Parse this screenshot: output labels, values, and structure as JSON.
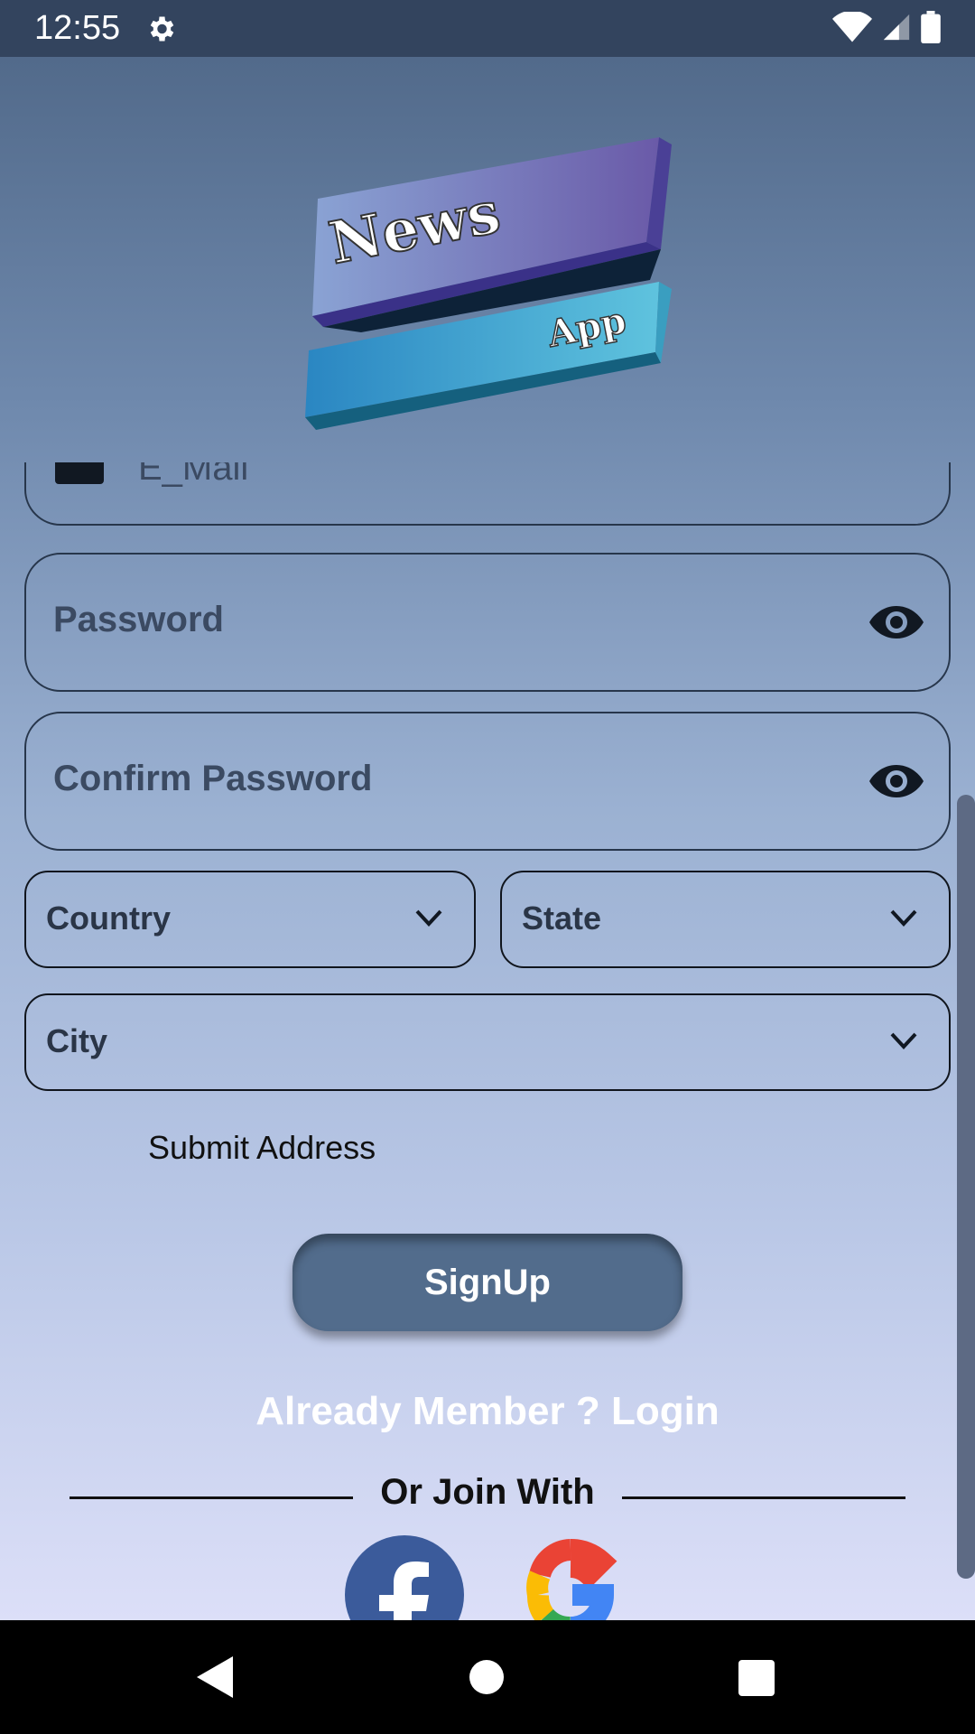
{
  "status_bar": {
    "time": "12:55"
  },
  "logo": {
    "word1": "News",
    "word2": "App"
  },
  "form": {
    "email_label": "E_Mail",
    "password_label": "Password",
    "confirm_password_label": "Confirm Password",
    "country_label": "Country",
    "state_label": "State",
    "city_label": "City",
    "submit_address": "Submit Address",
    "signup_button": "SignUp"
  },
  "login_link": "Already Member ? Login",
  "or_join_with": "Or Join With",
  "colors": {
    "status_bar": "#33445e",
    "signup_button": "#526c8c",
    "facebook": "#3b5b9b"
  }
}
